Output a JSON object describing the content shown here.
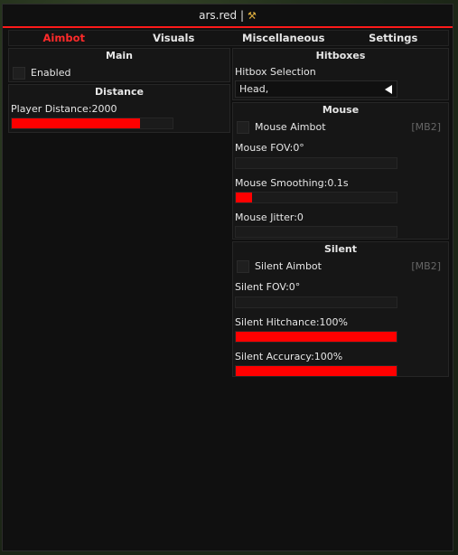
{
  "window": {
    "title": "ars.red | "
  },
  "tabs": [
    "Aimbot",
    "Visuals",
    "Miscellaneous",
    "Settings"
  ],
  "main": {
    "title": "Main",
    "enabled_label": "Enabled"
  },
  "distance": {
    "title": "Distance",
    "player_distance": "Player Distance:2000",
    "player_distance_fill": 0.8
  },
  "hitboxes": {
    "title": "Hitboxes",
    "selection_label": "Hitbox Selection",
    "selection_value": "Head,"
  },
  "mouse": {
    "title": "Mouse",
    "aimbot_label": "Mouse Aimbot",
    "aimbot_bind": "[MB2]",
    "fov": "Mouse FOV:0°",
    "fov_fill": 0,
    "smoothing": "Mouse Smoothing:0.1s",
    "smoothing_fill": 0.1,
    "jitter": "Mouse Jitter:0",
    "jitter_fill": 0
  },
  "silent": {
    "title": "Silent",
    "aimbot_label": "Silent Aimbot",
    "aimbot_bind": "[MB2]",
    "fov": "Silent FOV:0°",
    "fov_fill": 0,
    "hitchance": "Silent Hitchance:100%",
    "hitchance_fill": 1,
    "accuracy": "Silent Accuracy:100%",
    "accuracy_fill": 1
  },
  "colors": {
    "accent": "#ff0000",
    "background": "#101010"
  }
}
